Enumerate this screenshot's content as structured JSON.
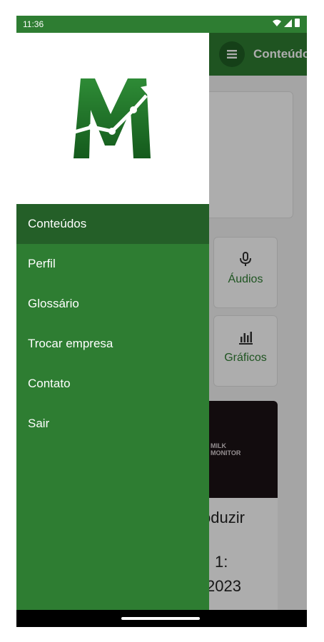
{
  "status_bar": {
    "time": "11:36",
    "icons": [
      "wifi-icon",
      "signal-icon",
      "battery-icon"
    ]
  },
  "app_bar": {
    "title": "Conteúdos",
    "menu_icon": "hamburger-icon"
  },
  "tiles": [
    {
      "label": "Áudios",
      "icon": "microphone-icon"
    },
    {
      "label": "Gráficos",
      "icon": "bar-chart-icon"
    }
  ],
  "media_card": {
    "thumbnail_logo_line1": "MILK",
    "thumbnail_logo_line2": "MONITOR",
    "text_line1": "oduzir",
    "text_line2": "1:",
    "text_line3": "2023"
  },
  "drawer": {
    "logo_icon": "m-growth-logo",
    "items": [
      {
        "label": "Conteúdos",
        "active": true
      },
      {
        "label": "Perfil",
        "active": false
      },
      {
        "label": "Glossário",
        "active": false
      },
      {
        "label": "Trocar empresa",
        "active": false
      },
      {
        "label": "Contato",
        "active": false
      },
      {
        "label": "Sair",
        "active": false
      }
    ]
  },
  "colors": {
    "primary": "#2e7d32",
    "drawer_active": "#245f28",
    "logo_dark": "#1b5e20",
    "tile_text": "#2e7d32"
  }
}
